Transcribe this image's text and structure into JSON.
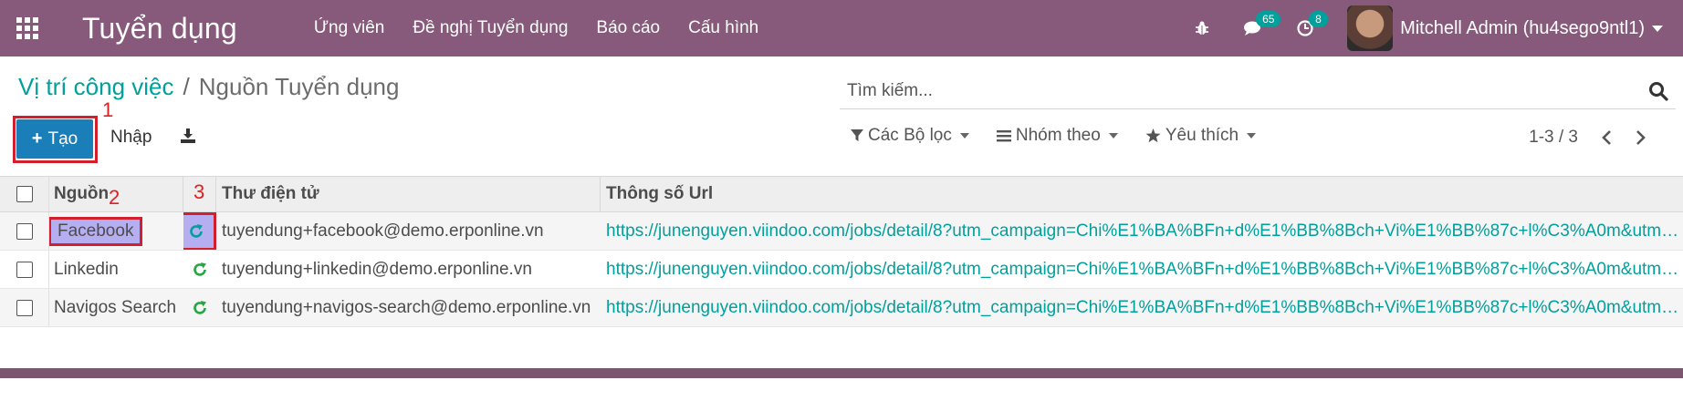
{
  "navbar": {
    "app_title": "Tuyển dụng",
    "menu": [
      "Ứng viên",
      "Đề nghị Tuyển dụng",
      "Báo cáo",
      "Cấu hình"
    ],
    "chat_badge": "65",
    "activity_badge": "8",
    "user_name": "Mitchell Admin (hu4sego9ntl1)"
  },
  "breadcrumb": {
    "parent": "Vị trí công việc",
    "separator": "/",
    "current": "Nguồn Tuyển dụng"
  },
  "search": {
    "placeholder": "Tìm kiếm..."
  },
  "toolbar": {
    "create_label": "Tạo",
    "import_label": "Nhập"
  },
  "filters": {
    "filter_label": "Các Bộ lọc",
    "group_label": "Nhóm theo",
    "favorite_label": "Yêu thích"
  },
  "pager": {
    "text": "1-3 / 3"
  },
  "table": {
    "headers": {
      "source": "Nguồn",
      "email": "Thư điện tử",
      "url": "Thông số Url"
    },
    "rows": [
      {
        "source": "Facebook",
        "email": "tuyendung+facebook@demo.erponline.vn",
        "url": "https://junenguyen.viindoo.com/jobs/detail/8?utm_campaign=Chi%E1%BA%BFn+d%E1%BB%8Bch+Vi%E1%BB%87c+l%C3%A0m&utm_medium=..."
      },
      {
        "source": "Linkedin",
        "email": "tuyendung+linkedin@demo.erponline.vn",
        "url": "https://junenguyen.viindoo.com/jobs/detail/8?utm_campaign=Chi%E1%BA%BFn+d%E1%BB%8Bch+Vi%E1%BB%87c+l%C3%A0m&utm_medium=..."
      },
      {
        "source": "Navigos Search",
        "email": "tuyendung+navigos-search@demo.erponline.vn",
        "url": "https://junenguyen.viindoo.com/jobs/detail/8?utm_campaign=Chi%E1%BA%BFn+d%E1%BB%8Bch+Vi%E1%BB%87c+l%C3%A0m&utm_medium=..."
      }
    ]
  },
  "annotations": {
    "one": "1",
    "two": "2",
    "three": "3"
  },
  "colors": {
    "brand": "#875a7b",
    "accent": "#00a09d",
    "primary": "#1a7fb9",
    "highlight": "#d11f2d"
  }
}
